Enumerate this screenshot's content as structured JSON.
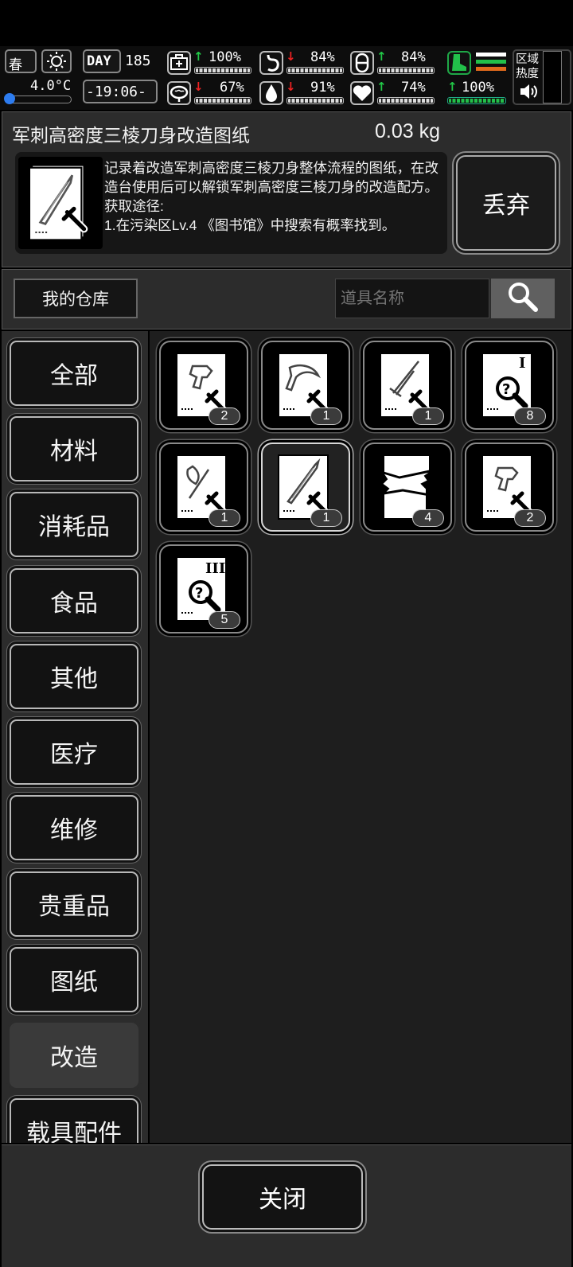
{
  "status_bar": {
    "season": "春",
    "day_label": "DAY",
    "day_number": "185",
    "temperature": "4.0°C",
    "time": "-19:06-",
    "stats": {
      "health": {
        "percent": "100%",
        "trend": "up"
      },
      "hunger": {
        "percent": "84%",
        "trend": "down"
      },
      "stamina": {
        "percent": "84%",
        "trend": "up"
      },
      "sanity": {
        "percent": "67%",
        "trend": "down"
      },
      "thirst": {
        "percent": "91%",
        "trend": "down"
      },
      "mood": {
        "percent": "74%",
        "trend": "up"
      },
      "energy": {
        "percent": "100%",
        "trend": "up"
      }
    },
    "zone_label": "区域热度"
  },
  "item_detail": {
    "name": "军刺高密度三棱刀身改造图纸",
    "weight": "0.03 kg",
    "description": "记录着改造军刺高密度三棱刀身整体流程的图纸，在改造台使用后可以解锁军刺高密度三棱刀身的改造配方。",
    "source_label": "获取途径:",
    "source_detail": "1.在污染区Lv.4 《图书馆》中搜索有概率找到。",
    "discard_label": "丢弃"
  },
  "storage": {
    "my_storage_label": "我的仓库",
    "search_placeholder": "道具名称"
  },
  "categories": [
    "全部",
    "材料",
    "消耗品",
    "食品",
    "其他",
    "医疗",
    "维修",
    "贵重品",
    "图纸",
    "改造",
    "载具配件"
  ],
  "active_category": "改造",
  "items": [
    {
      "icon": "blueprint-gun-parts-icon",
      "count": "2"
    },
    {
      "icon": "blueprint-blade-icon",
      "count": "1"
    },
    {
      "icon": "blueprint-spike-icon",
      "count": "1"
    },
    {
      "icon": "blueprint-unknown-tier1-icon",
      "count": "8"
    },
    {
      "icon": "blueprint-axe-icon",
      "count": "1"
    },
    {
      "icon": "blueprint-bayonet-icon",
      "count": "1",
      "selected": true
    },
    {
      "icon": "torn-blueprint-icon",
      "count": "4"
    },
    {
      "icon": "blueprint-gun-parts-icon",
      "count": "2"
    },
    {
      "icon": "blueprint-unknown-tier3-icon",
      "count": "5"
    }
  ],
  "close_label": "关闭",
  "colors": {
    "up_arrow": "#21c847",
    "down_arrow": "#ee2222",
    "panel": "#2c2c2c",
    "grid_bg": "#1e1e1e"
  }
}
